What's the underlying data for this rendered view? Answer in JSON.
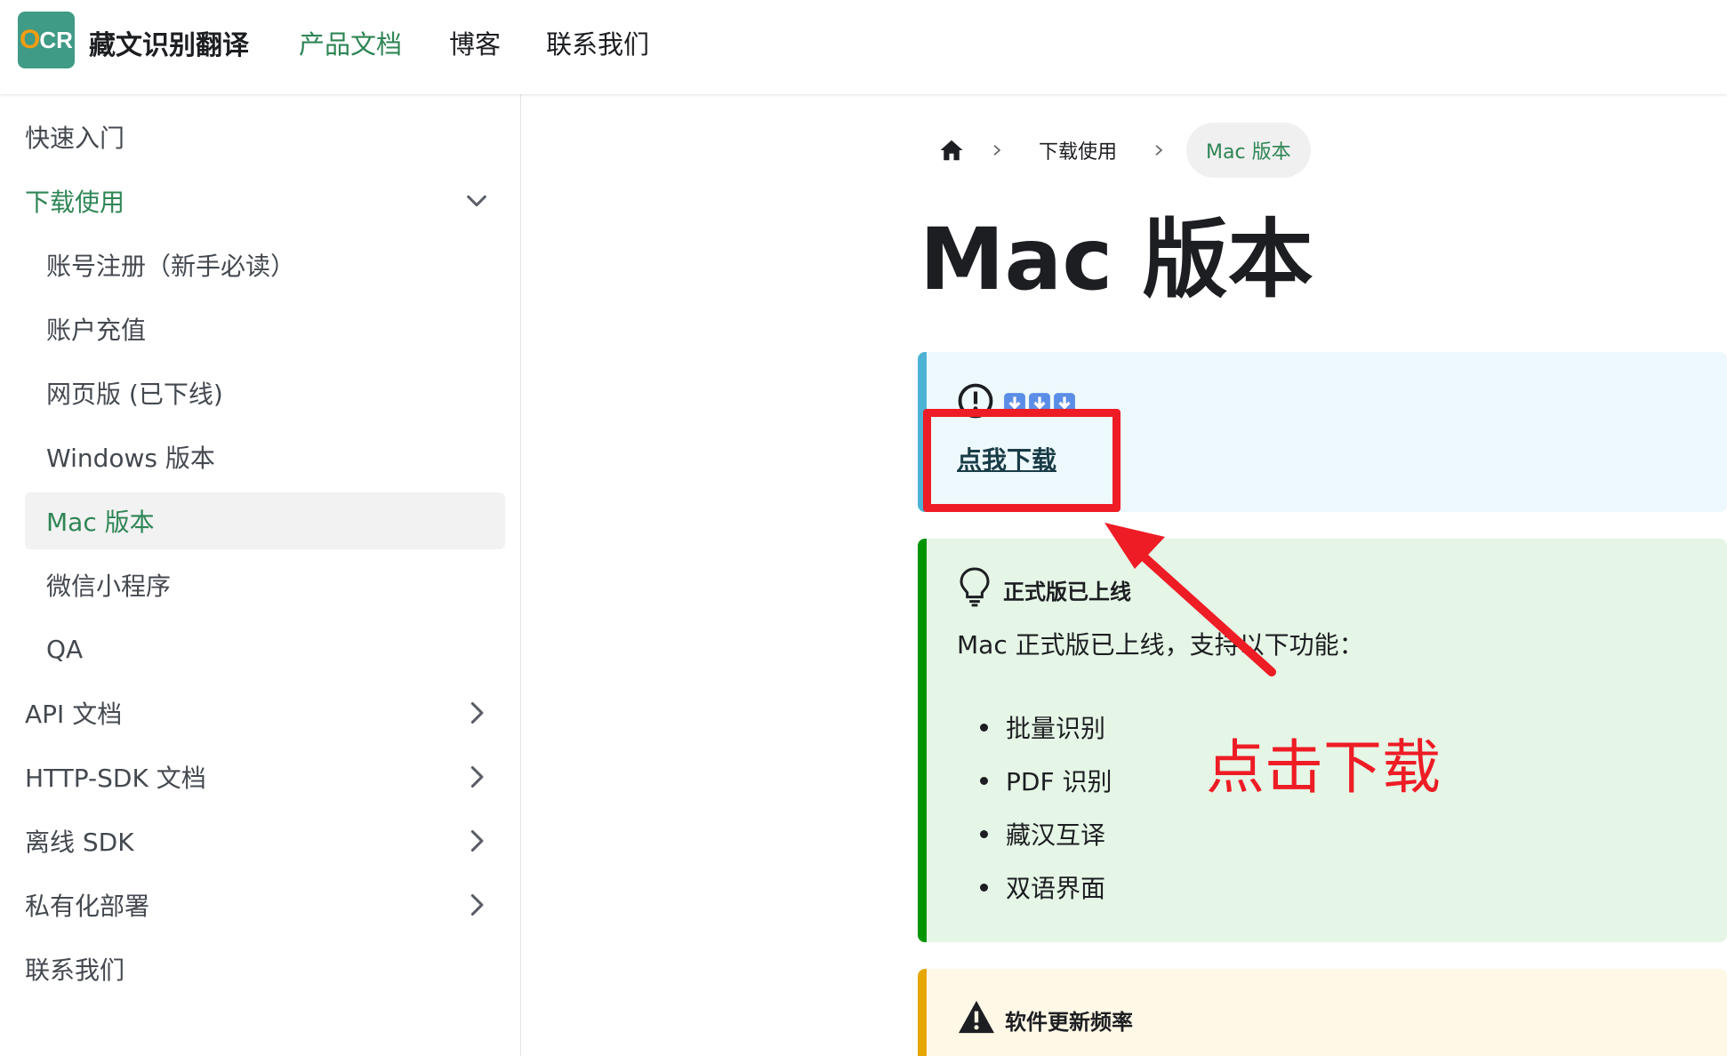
{
  "navbar": {
    "logo_o": "O",
    "logo_cr": "CR",
    "brand": "藏文识别翻译",
    "links": [
      "产品文档",
      "博客",
      "联系我们"
    ]
  },
  "sidebar": {
    "items": [
      {
        "label": "快速入门"
      },
      {
        "label": "下载使用"
      },
      {
        "label": "账号注册（新手必读）"
      },
      {
        "label": "账户充值"
      },
      {
        "label": "网页版 (已下线)"
      },
      {
        "label": "Windows 版本"
      },
      {
        "label": "Mac 版本"
      },
      {
        "label": "微信小程序"
      },
      {
        "label": "QA"
      },
      {
        "label": "API 文档"
      },
      {
        "label": "HTTP-SDK 文档"
      },
      {
        "label": "离线 SDK"
      },
      {
        "label": "私有化部署"
      },
      {
        "label": "联系我们"
      }
    ]
  },
  "breadcrumb": {
    "items": [
      "下载使用",
      "Mac 版本"
    ]
  },
  "page": {
    "title": "Mac 版本"
  },
  "info_admonition": {
    "link": "点我下载"
  },
  "tip_admonition": {
    "heading": "正式版已上线",
    "body": "Mac 正式版已上线，支持以下功能：",
    "features": [
      "批量识别",
      "PDF 识别",
      "藏汉互译",
      "双语界面"
    ]
  },
  "warning_admonition": {
    "heading": "软件更新频率"
  },
  "annotation": {
    "text": "点击下载",
    "color": "#ee1c25"
  },
  "colors": {
    "accent": "#2e8555",
    "info_border": "#4cb3d4",
    "tip_border": "#009400",
    "warn_border": "#e6a700"
  }
}
